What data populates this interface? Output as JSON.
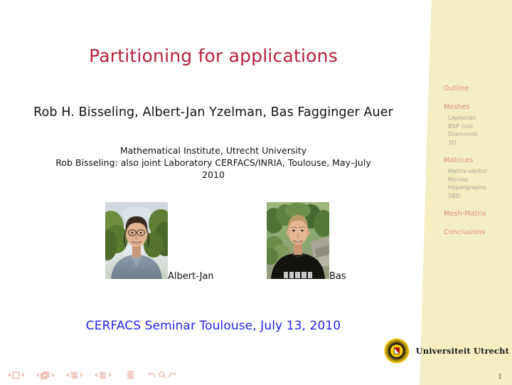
{
  "slide": {
    "title": "Partitioning for applications",
    "authors": "Rob H. Bisseling, Albert-Jan Yzelman, Bas Fagginger Auer",
    "affiliation_line1": "Mathematical Institute, Utrecht University",
    "affiliation_line2": "Rob Bisseling: also joint Laboratory CERFACS/INRIA, Toulouse, May–July",
    "affiliation_line3": "2010",
    "event": "CERFACS Seminar Toulouse, July 13, 2010",
    "page_number": "1"
  },
  "photos": [
    {
      "name": "albert-jan-photo",
      "caption": "Albert-Jan"
    },
    {
      "name": "bas-photo",
      "caption": "Bas"
    }
  ],
  "sidebar": {
    "items": [
      {
        "label": "Outline",
        "level": "section"
      },
      {
        "label": "Meshes",
        "level": "section"
      },
      {
        "label": "Laplacian",
        "level": "subsection"
      },
      {
        "label": "BSP cost",
        "level": "subsection"
      },
      {
        "label": "Diamonds",
        "level": "subsection"
      },
      {
        "label": "3D",
        "level": "subsection"
      },
      {
        "label": "Matrices",
        "level": "section"
      },
      {
        "label": "Matrix-vector",
        "level": "subsection"
      },
      {
        "label": "Movies",
        "level": "subsection"
      },
      {
        "label": "Hypergraphs",
        "level": "subsection"
      },
      {
        "label": "SBD",
        "level": "subsection"
      },
      {
        "label": "Mesh-Matrix",
        "level": "section"
      },
      {
        "label": "Conclusions",
        "level": "section"
      }
    ]
  },
  "logo": {
    "wordmark": "Universiteit Utrecht"
  },
  "navigation": {
    "groups": [
      {
        "name": "slide-navigation",
        "icon": "square-frame-icon"
      },
      {
        "name": "frame-navigation",
        "icon": "stacked-frames-icon"
      },
      {
        "name": "subsection-navigation",
        "icon": "subsection-bars-icon"
      },
      {
        "name": "section-navigation",
        "icon": "section-bars-icon"
      }
    ],
    "presentation_icon": "document-bars-icon",
    "back_icon": "back-arrow-icon",
    "find_icon": "magnifier-icon",
    "forward_icon": "forward-arrow-icon"
  },
  "colors": {
    "title": "#b5223a",
    "event": "#2222ee",
    "sidebar_bg": "#f4eec2",
    "sidebar_section": "#e28a80",
    "sidebar_subsection": "#a8a89c",
    "nav_symbols": "#f0b9b0",
    "logo_gold": "#ffcd00"
  }
}
